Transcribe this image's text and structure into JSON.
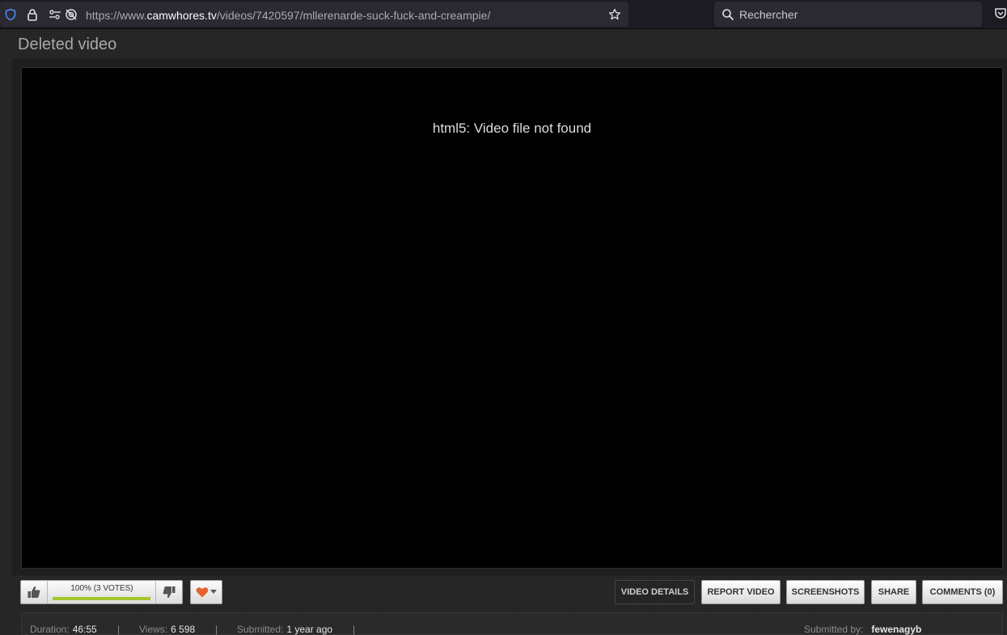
{
  "browser": {
    "url_prefix": "https://www.",
    "url_domain": "camwhores.tv",
    "url_path": "/videos/7420597/mllerenarde-suck-fuck-and-creampie/",
    "search_placeholder": "Rechercher"
  },
  "page": {
    "title": "Deleted video",
    "player_error": "html5: Video file not found"
  },
  "rating": {
    "text": "100% (3 VOTES)",
    "percent": 100
  },
  "tabs": [
    {
      "label": "VIDEO DETAILS",
      "active": true
    },
    {
      "label": "REPORT VIDEO",
      "active": false
    },
    {
      "label": "SCREENSHOTS",
      "active": false
    },
    {
      "label": "SHARE",
      "active": false
    },
    {
      "label": "COMMENTS (0)",
      "active": false
    }
  ],
  "info": {
    "duration_label": "Duration:",
    "duration_value": "46:55",
    "views_label": "Views:",
    "views_value": "6 598",
    "submitted_label": "Submitted:",
    "submitted_value": "1 year ago",
    "submitted_by_label": "Submitted by:",
    "submitted_by_value": "fewenagyb",
    "separator": "|"
  },
  "colors": {
    "accent_rating": "#a3c62c",
    "heart": "#e8612c",
    "shield": "#4f8ef7"
  },
  "icons": [
    "shield-icon",
    "lock-icon",
    "permissions-icon",
    "tracking-off-icon",
    "star-icon",
    "search-icon",
    "pocket-icon",
    "thumbs-up-icon",
    "thumbs-down-icon",
    "heart-icon",
    "caret-down-icon"
  ]
}
